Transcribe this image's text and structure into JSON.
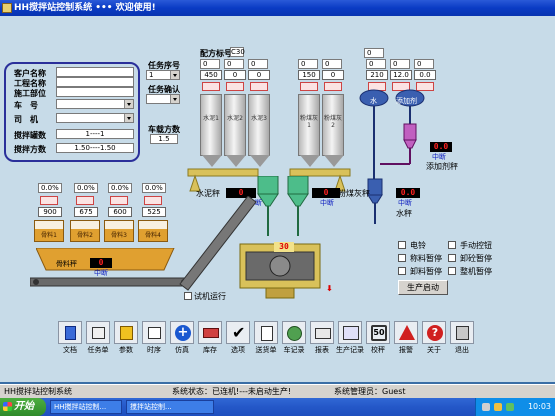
{
  "window": {
    "title": "HH搅拌站控制系统 ••• 欢迎使用!"
  },
  "customer_panel": {
    "labels": [
      "客户名称",
      "工程名称",
      "施工部位",
      "车　号",
      "司　机",
      "搅拌罐数",
      "搅拌方数"
    ],
    "tank_count_value": "1----1",
    "mix_volume_value": "1.50----1.50"
  },
  "task": {
    "task_no_label": "任务序号",
    "task_no_value": "1",
    "task_confirm_label": "任务确认",
    "truck_volume_label": "车载方数",
    "truck_volume_value": "1.5"
  },
  "recipe": {
    "label": "配方标号",
    "value": "C30"
  },
  "silos": {
    "cement_labels": [
      "水泥1",
      "水泥2",
      "水泥3"
    ],
    "fly_ash_labels": [
      "粉煤灰1",
      "粉煤灰2"
    ],
    "values": [
      "450",
      "0",
      "0",
      "150",
      "0"
    ],
    "top_values": [
      "0",
      "0",
      "0",
      "0",
      "0",
      "0",
      "0",
      "0",
      "0",
      "0"
    ]
  },
  "water": {
    "top_value": "0",
    "values": [
      "210",
      "12.0",
      "0.0"
    ],
    "water_label": "水",
    "additive_label": "添加剂",
    "additive_scale_label": "添加剂秤",
    "water_scale_label": "水秤",
    "water_scale_display": "0.0"
  },
  "scales": {
    "cement_scale_label": "水泥秤",
    "cement_scale_display": "0",
    "cement_interrupt": "中断",
    "fly_ash_scale_label": "粉煤灰秤",
    "fly_ash_scale_display": "0",
    "fly_ash_interrupt": "中断",
    "water_interrupt": "中断",
    "additive_interrupt": "中断"
  },
  "aggregates": {
    "percents": [
      "0.0%",
      "0.0%",
      "0.0%",
      "0.0%"
    ],
    "values": [
      "900",
      "675",
      "600",
      "525"
    ],
    "labels": [
      "骨料1",
      "骨料2",
      "骨料3",
      "骨料4"
    ],
    "scale_label": "骨料秤",
    "scale_display": "0",
    "scale_interrupt": "中断"
  },
  "mixer": {
    "display": "30",
    "machine_run_label": "试机运行"
  },
  "controls": {
    "checkboxes": [
      "电铃",
      "称料暂停",
      "卸料暂停",
      "手动控钮",
      "卸砼暂停",
      "整机暂停"
    ],
    "start_production": "生产启动"
  },
  "toolbar": [
    "文档",
    "任务单",
    "参数",
    "时序",
    "仿真",
    "库存",
    "选项",
    "送货单",
    "车记录",
    "报表",
    "生产记录",
    "校秤",
    "报警",
    "关于",
    "退出"
  ],
  "statusbar": {
    "app_name": "HH搅拌站控制系统",
    "system_status": "系统状态：已连机!---未启动生产!",
    "admin": "系统管理员：Guest"
  },
  "taskbar": {
    "start": "开始",
    "items": [
      "HH搅拌站控制...",
      "搅拌站控制..."
    ],
    "clock": "10:03"
  },
  "colors": {
    "title_bar": "#0a3bc4",
    "client_bg": "#c7dbe8",
    "hopper": "#e0a030",
    "conveyor": "#d9c15a",
    "pipe_green": "#4dbd8a",
    "pipe_blue": "#3a5fb0",
    "led_red": "#ff2222"
  }
}
